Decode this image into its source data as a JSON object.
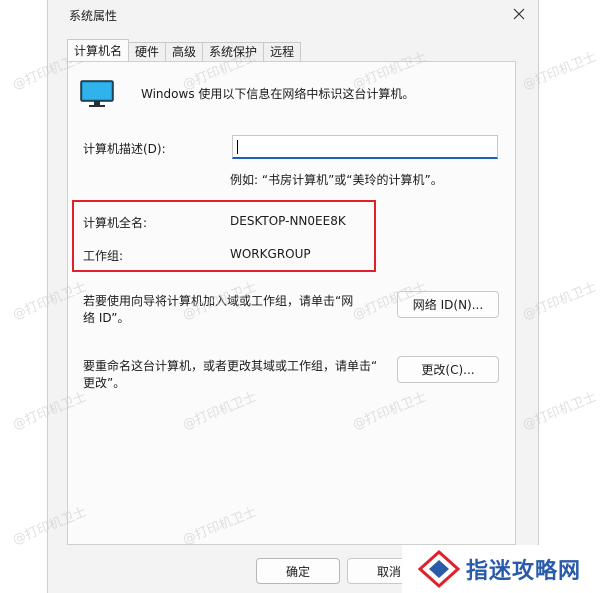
{
  "window": {
    "title": "系统属性",
    "close_glyph": "✕"
  },
  "tabs": [
    {
      "label": "计算机名",
      "active": true
    },
    {
      "label": "硬件",
      "active": false
    },
    {
      "label": "高级",
      "active": false
    },
    {
      "label": "系统保护",
      "active": false
    },
    {
      "label": "远程",
      "active": false
    }
  ],
  "intro": "Windows 使用以下信息在网络中标识这台计算机。",
  "description": {
    "label": "计算机描述(D):",
    "value": "",
    "example": "例如: “书房计算机”或“美玲的计算机”。"
  },
  "fullname": {
    "label": "计算机全名:",
    "value": "DESKTOP-NN0EE8K"
  },
  "workgroup": {
    "label": "工作组:",
    "value": "WORKGROUP"
  },
  "network_section": {
    "text_line1": "若要使用向导将计算机加入域或工作组，请单击“网",
    "text_line2": "络 ID”。",
    "button": "网络 ID(N)..."
  },
  "rename_section": {
    "text_line1": "要重命名这台计算机，或者更改其域或工作组，请单击“",
    "text_line2": "更改”。",
    "button": "更改(C)..."
  },
  "footer": {
    "ok": "确定",
    "cancel": "取消"
  },
  "brand": {
    "text": "指迷攻略网"
  },
  "watermark": "@打印机卫士",
  "colors": {
    "highlight": "#e0212c",
    "input_focus": "#1b5fbf",
    "brand": "#2a5bab",
    "monitor": "#1a9ad6"
  }
}
